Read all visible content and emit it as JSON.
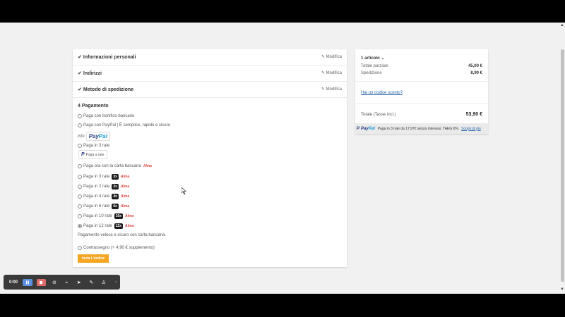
{
  "checkout": {
    "sections": [
      {
        "label": "Informazioni personali",
        "edit": "Modifica"
      },
      {
        "label": "Indirizzi",
        "edit": "Modifica"
      },
      {
        "label": "Metodo di spedizione",
        "edit": "Modifica"
      }
    ],
    "payment_title": "4  Pagamento",
    "options": [
      {
        "label": "Paga con bonifico bancario"
      },
      {
        "label": "Paga con PayPal | È semplice, rapido e sicuro"
      },
      {
        "label": "Paga in 3 rate"
      },
      {
        "label": "Paga ora con la carta bancaria",
        "alma": "Alma"
      },
      {
        "label": "Paga in 3 rate",
        "badge": "3x",
        "alma": "Alma"
      },
      {
        "label": "Paga in 2 rate",
        "badge": "2x",
        "alma": "Alma"
      },
      {
        "label": "Paga in 4 rate",
        "badge": "4x",
        "alma": "Alma"
      },
      {
        "label": "Paga in 6 rate",
        "badge": "6x",
        "alma": "Alma"
      },
      {
        "label": "Paga in 10 rate",
        "badge": "10x",
        "alma": "Alma"
      },
      {
        "label": "Paga in 12 rate",
        "badge": "12x",
        "alma": "Alma"
      },
      {
        "label": "Contrassegno (+ 4,90 € supplemento)"
      }
    ],
    "info_label": "info",
    "paypal_logo_dark": "Pay",
    "paypal_logo_light": "Pal",
    "rate_button_label": "Paga a rate",
    "selected_note": "Pagamento veloce e sicuro con carta bancaria.",
    "order_button": "Invia L'ordine"
  },
  "summary": {
    "items": "1 articolo",
    "subtotal_label": "Totale parziale",
    "subtotal_value": "45,00 €",
    "shipping_label": "Spedizione",
    "shipping_value": "8,90 €",
    "discount_link": "Hai un codice sconto?",
    "total_label": "Totale (Tasse incl.)",
    "total_value": "53,90 €",
    "paypal_text": "Paga in 3 rate da 17,97€ senza interessi. TAEG 0%.",
    "paypal_link": "Scopri di più"
  },
  "recorder": {
    "time": "0:00"
  },
  "colors": {
    "accent": "#f5a623",
    "alma": "#e2423c",
    "link": "#1f5ea8",
    "recbar": "#3a3a3a"
  }
}
